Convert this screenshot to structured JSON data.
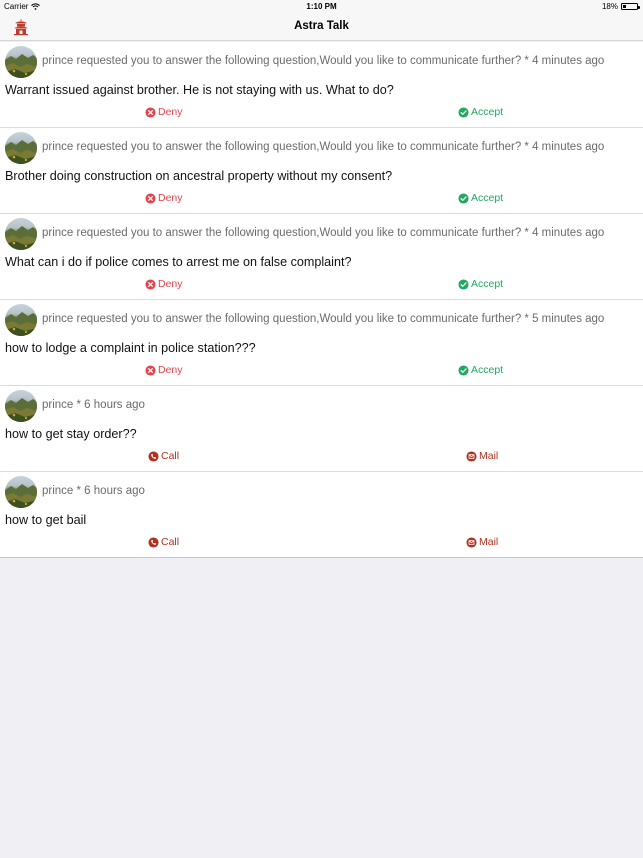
{
  "status_bar": {
    "carrier": "Carrier",
    "time": "1:10 PM",
    "battery": "18%",
    "battery_level": 0.18
  },
  "nav": {
    "title": "Astra Talk",
    "left_icon": "temple-icon",
    "accent": "#c0392b"
  },
  "colors": {
    "deny": "#e8434b",
    "accept": "#1fa95e",
    "contact": "#b3301e"
  },
  "items": [
    {
      "meta": "prince requested you to answer the following question,Would you like to communicate further? * 4 minutes ago",
      "question": "Warrant issued against brother. He is not staying with us. What to do?",
      "type": "request",
      "left_action": "Deny",
      "right_action": "Accept"
    },
    {
      "meta": "prince requested you to answer the following question,Would you like to communicate further? * 4 minutes ago",
      "question": "Brother doing construction on ancestral property without my consent?",
      "type": "request",
      "left_action": "Deny",
      "right_action": "Accept"
    },
    {
      "meta": "prince requested you to answer the following question,Would you like to communicate further? * 4 minutes ago",
      "question": "What can i do if police comes to arrest me on false complaint?",
      "type": "request",
      "left_action": "Deny",
      "right_action": "Accept"
    },
    {
      "meta": "prince requested you to answer the following question,Would you like to communicate further? * 5 minutes ago",
      "question": "how to lodge a complaint in police station???",
      "type": "request",
      "left_action": "Deny",
      "right_action": "Accept"
    },
    {
      "meta": "prince * 6 hours ago",
      "question": "how to get stay order??",
      "type": "contact",
      "left_action": "Call",
      "right_action": "Mail"
    },
    {
      "meta": "prince * 6 hours ago",
      "question": "how to get bail",
      "type": "contact",
      "left_action": "Call",
      "right_action": "Mail"
    }
  ]
}
